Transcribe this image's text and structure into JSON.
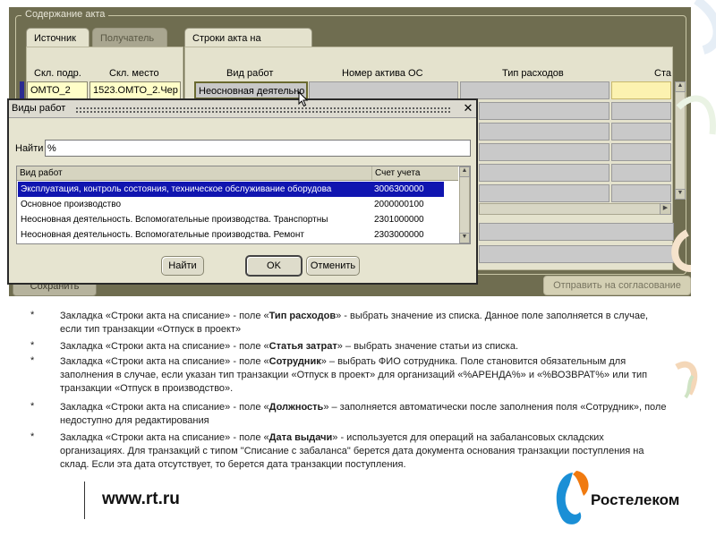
{
  "form": {
    "section_title": "Содержание акта",
    "tabs": [
      "Источник",
      "Получатель",
      "Строки акта на списание"
    ],
    "left_headers": [
      "Скл. подр.",
      "Скл. место"
    ],
    "left_row": [
      "ОМТО_2",
      "1523.ОМТО_2.Чер"
    ],
    "right_headers": [
      "Вид работ",
      "Номер актива ОС",
      "Тип расходов",
      "Ста"
    ],
    "first_row_work_type": "Неосновная деятельно",
    "save_button": "Сохранить",
    "send_button": "Отправить на согласование"
  },
  "dialog": {
    "title": "Виды работ",
    "find_label": "Найти",
    "find_value": "%",
    "columns": [
      "Вид работ",
      "Счет учета"
    ],
    "rows": [
      {
        "name": "Эксплуатация, контроль состояния, техническое обслуживание оборудова",
        "account": "3006300000"
      },
      {
        "name": "Основное производство",
        "account": "2000000100"
      },
      {
        "name": "Неосновная деятельность. Вспомогательные производства. Транспортны",
        "account": "2301000000"
      },
      {
        "name": "Неосновная деятельность. Вспомогательные производства. Ремонт",
        "account": "2303000000"
      }
    ],
    "buttons": {
      "find": "Найти",
      "ok": "OK",
      "cancel": "Отменить"
    }
  },
  "notes": [
    {
      "pre": "Закладка «Строки акта на списание»  - поле «",
      "field": "Тип расходов",
      "post": "» -  выбрать значение из списка. Данное поле заполняется в случае, если тип транзакции «Отпуск в проект»"
    },
    {
      "pre": "Закладка «Строки акта на списание»  - поле «",
      "field": "Статья затрат",
      "post": "» – выбрать значение статьи из списка."
    },
    {
      "pre": "Закладка «Строки акта на списание»  - поле «",
      "field": "Сотрудник",
      "post": "» – выбрать ФИО сотрудника. Поле становится обязательным для заполнения в случае, если указан тип транзакции «Отпуск в проект» для организаций «%АРЕНДА%» и «%ВОЗВРАТ%» или тип транзакции «Отпуск в производство»."
    },
    {
      "pre": "Закладка «Строки акта на списание»  - поле «",
      "field": "Должность",
      "post": "» – заполняется автоматически после заполнения поля «Сотрудник», поле недоступно для редактирования"
    },
    {
      "pre": "Закладка «Строки акта на списание»  - поле «",
      "field": "Дата выдачи",
      "post": "» - используется для операций на забалансовых складских организациях. Для транзакций с типом \"Списание с забаланса\" берется дата документа основания транзакции поступления на склад. Если эта дата отсутствует, то берется дата транзакции поступления."
    }
  ],
  "bullet": "*",
  "footer": {
    "url": "www.rt.ru",
    "brand": "Ростелеком"
  },
  "colors": {
    "form_bg": "#6f6d50",
    "panel": "#e4e2cd",
    "list_selection": "#1015b0",
    "logo_blue": "#1a8fd6",
    "logo_orange": "#f07a10"
  }
}
